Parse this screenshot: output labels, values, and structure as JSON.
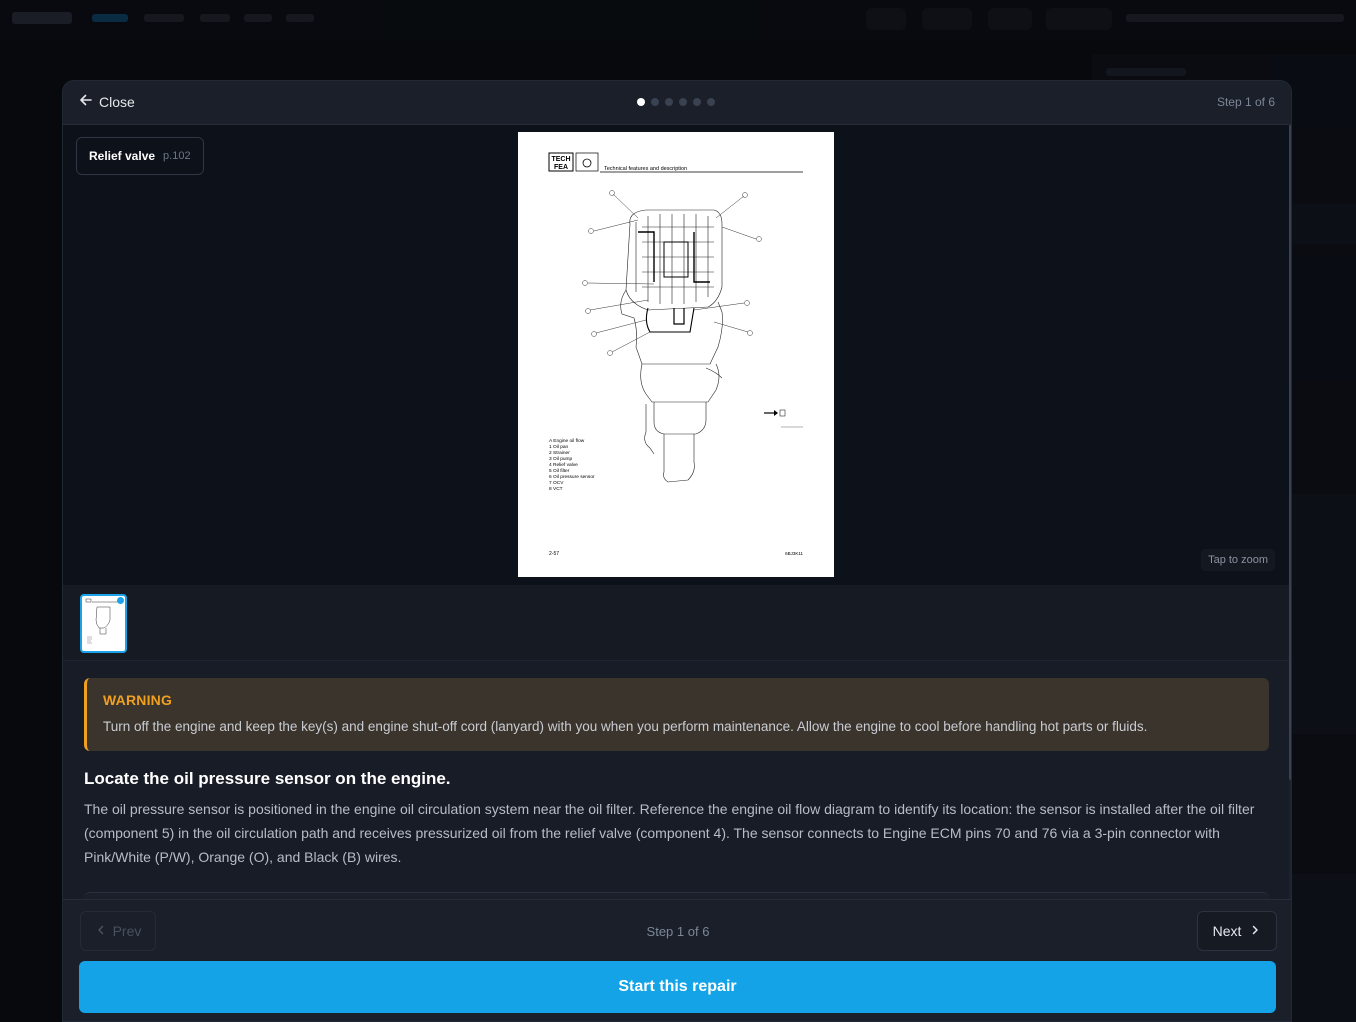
{
  "modal": {
    "close_label": "Close",
    "step_indicator": "Step 1 of 6",
    "total_steps": 6,
    "active_step": 1
  },
  "viewer": {
    "reference_title": "Relief valve",
    "reference_page": "p.102",
    "zoom_hint": "Tap to zoom",
    "manual_page": {
      "header_badge": "TECH\nFEA",
      "header_title": "Technical features and description",
      "legend": [
        "A Engine oil flow",
        "1 Oil pan",
        "2 Strainer",
        "3 Oil pump",
        "4 Relief valve",
        "5 Oil filter",
        "6 Oil pressure sensor",
        "7 OCV",
        "8 VCT"
      ],
      "page_number": "2-57",
      "page_code": "6BJ3K11"
    }
  },
  "warning": {
    "title": "WARNING",
    "body": "Turn off the engine and keep the key(s) and engine shut-off cord (lanyard) with you when you perform maintenance. Allow the engine to cool before handling hot parts or fluids."
  },
  "step": {
    "title": "Locate the oil pressure sensor on the engine.",
    "body": "The oil pressure sensor is positioned in the engine oil circulation system near the oil filter. Reference the engine oil flow diagram to identify its location: the sensor is installed after the oil filter (component 5) in the oil circulation path and receives pressurized oil from the relief valve (component 4). The sensor connects to Engine ECM pins 70 and 76 via a 3-pin connector with Pink/White (P/W), Orange (O), and Black (B) wires."
  },
  "footer": {
    "prev_label": "Prev",
    "next_label": "Next",
    "step_indicator": "Step 1 of 6",
    "start_label": "Start this repair"
  },
  "colors": {
    "accent": "#13a3e6",
    "warning": "#f0a020",
    "modal_bg": "#171c26"
  }
}
